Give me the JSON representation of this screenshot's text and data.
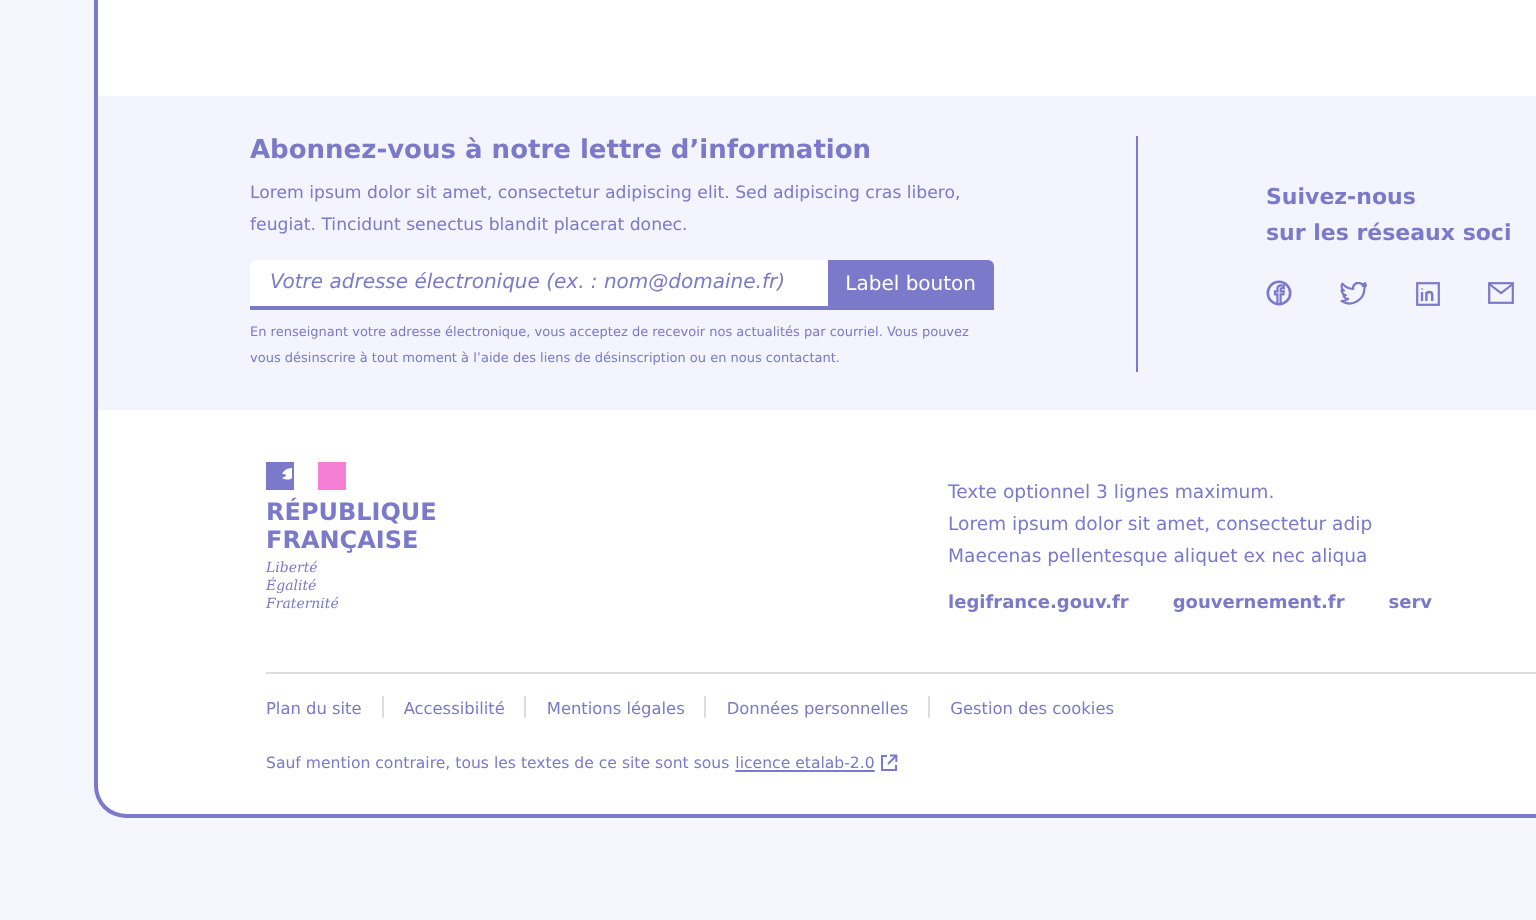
{
  "newsletter": {
    "title": "Abonnez-vous à notre lettre d’information",
    "description": "Lorem ipsum dolor sit amet, consectetur adipiscing elit. Sed adipiscing cras libero, feugiat. Tincidunt senectus blandit placerat donec.",
    "email_placeholder": "Votre adresse électronique (ex. : nom@domaine.fr)",
    "button": "Label bouton",
    "notice": "En renseignant votre adresse électronique, vous acceptez de recevoir nos actualités par courriel. Vous pouvez vous désinscrire à tout moment à l’aide des liens de désinscription ou en nous contactant."
  },
  "social": {
    "title_lines": [
      "Suivez-nous",
      "sur les réseaux soci"
    ],
    "networks": [
      {
        "kind": "facebook"
      },
      {
        "kind": "twitter"
      },
      {
        "kind": "linkedin"
      },
      {
        "kind": "mail"
      }
    ]
  },
  "brand": {
    "name_lines": [
      "RÉPUBLIQUE",
      "FRANÇAISE"
    ],
    "motto_lines": [
      "Liberté",
      "Égalité",
      "Fraternité"
    ]
  },
  "footer": {
    "text_lines": [
      "Texte optionnel 3 lignes maximum.",
      "Lorem ipsum dolor sit amet, consectetur adip",
      "Maecenas pellentesque aliquet ex nec aliqua"
    ],
    "links": [
      "legifrance.gouv.fr",
      "gouvernement.fr",
      "serv"
    ],
    "bottom_links": [
      "Plan du site",
      "Accessibilité",
      "Mentions légales",
      "Données personnelles",
      "Gestion des cookies"
    ],
    "license_text": "Sauf mention contraire, tous les textes de ce site sont sous",
    "license_link": "licence etalab-2.0"
  }
}
